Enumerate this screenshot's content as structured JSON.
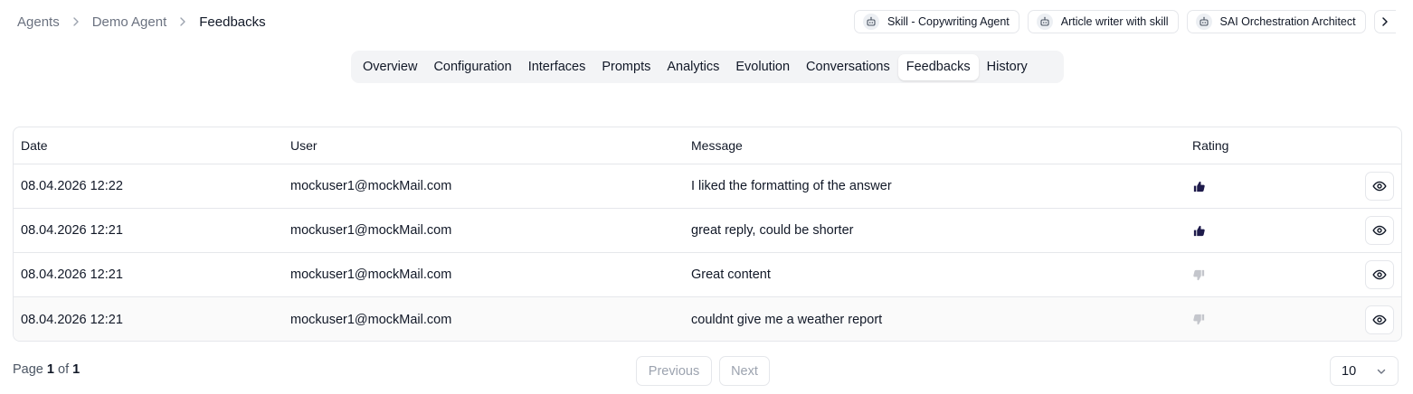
{
  "breadcrumb": {
    "items": [
      "Agents",
      "Demo Agent",
      "Feedbacks"
    ]
  },
  "agent_chips": [
    {
      "label": "Skill - Copywriting Agent",
      "icon": "robot-icon"
    },
    {
      "label": "Article writer with skill",
      "icon": "robot-icon"
    },
    {
      "label": "SAI Orchestration Architect",
      "icon": "robot-icon"
    }
  ],
  "tabs": [
    {
      "label": "Overview"
    },
    {
      "label": "Configuration"
    },
    {
      "label": "Interfaces"
    },
    {
      "label": "Prompts"
    },
    {
      "label": "Analytics"
    },
    {
      "label": "Evolution"
    },
    {
      "label": "Conversations"
    },
    {
      "label": "Feedbacks",
      "active": true
    },
    {
      "label": "History"
    }
  ],
  "table": {
    "headers": {
      "date": "Date",
      "user": "User",
      "message": "Message",
      "rating": "Rating"
    },
    "rows": [
      {
        "date": "08.04.2026 12:22",
        "user": "mockuser1@mockMail.com",
        "message": "I liked the formatting of the answer",
        "rating": "thumbs-up"
      },
      {
        "date": "08.04.2026 12:21",
        "user": "mockuser1@mockMail.com",
        "message": "great reply, could be shorter",
        "rating": "thumbs-up"
      },
      {
        "date": "08.04.2026 12:21",
        "user": "mockuser1@mockMail.com",
        "message": "Great content",
        "rating": "thumbs-down"
      },
      {
        "date": "08.04.2026 12:21",
        "user": "mockuser1@mockMail.com",
        "message": "couldnt give me a weather report",
        "rating": "thumbs-down"
      }
    ]
  },
  "pagination": {
    "page_word": "Page",
    "of_word": "of",
    "current": "1",
    "total": "1",
    "previous_label": "Previous",
    "next_label": "Next",
    "page_size": "10"
  },
  "colors": {
    "thumbs_up": "#1e1b4b",
    "thumbs_down": "#c4c6cc",
    "border": "#e5e7eb",
    "tab_bar_bg": "#f3f4f6"
  }
}
